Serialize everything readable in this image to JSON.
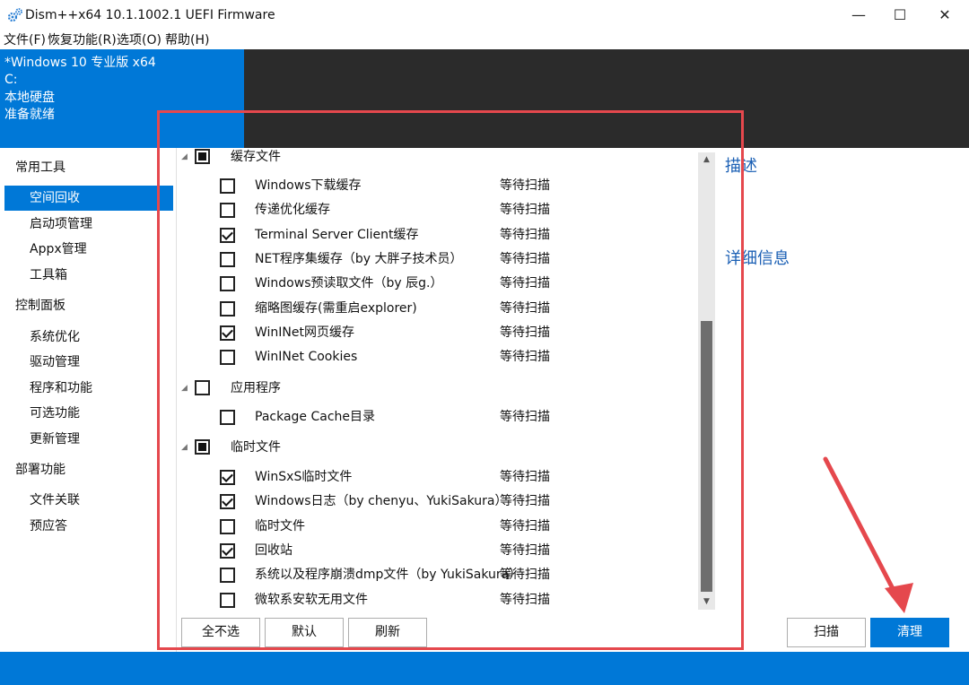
{
  "window": {
    "title": "Dism++x64 10.1.1002.1 UEFI Firmware",
    "minimize": "—",
    "maximize": "☐",
    "close": "✕"
  },
  "menu": [
    "文件(F)",
    "恢复功能(R)",
    "选项(O)",
    "帮助(H)"
  ],
  "header": {
    "lines": [
      "*Windows 10 专业版 x64",
      "C:",
      "本地硬盘",
      "准备就绪"
    ]
  },
  "sidebar": {
    "categories": [
      {
        "label": "常用工具",
        "items": [
          "空间回收",
          "启动项管理",
          "Appx管理",
          "工具箱"
        ]
      },
      {
        "label": "控制面板",
        "items": [
          "系统优化",
          "驱动管理",
          "程序和功能",
          "可选功能",
          "更新管理"
        ]
      },
      {
        "label": "部署功能",
        "items": [
          "文件关联",
          "预应答"
        ]
      }
    ],
    "selected": "空间回收"
  },
  "tree": {
    "groups": [
      {
        "label": "缓存文件",
        "state": "partial",
        "items": [
          {
            "label": "Windows下载缓存",
            "checked": false,
            "status": "等待扫描"
          },
          {
            "label": "传递优化缓存",
            "checked": false,
            "status": "等待扫描"
          },
          {
            "label": "Terminal Server Client缓存",
            "checked": true,
            "status": "等待扫描"
          },
          {
            "label": "NET程序集缓存（by 大胖子技术员）",
            "checked": false,
            "status": "等待扫描"
          },
          {
            "label": "Windows预读取文件（by 辰g.）",
            "checked": false,
            "status": "等待扫描"
          },
          {
            "label": "缩略图缓存(需重启explorer)",
            "checked": false,
            "status": "等待扫描"
          },
          {
            "label": "WinINet网页缓存",
            "checked": true,
            "status": "等待扫描"
          },
          {
            "label": "WinINet Cookies",
            "checked": false,
            "status": "等待扫描"
          }
        ]
      },
      {
        "label": "应用程序",
        "state": "unchecked",
        "items": [
          {
            "label": "Package Cache目录",
            "checked": false,
            "status": "等待扫描"
          }
        ]
      },
      {
        "label": "临时文件",
        "state": "partial",
        "items": [
          {
            "label": "WinSxS临时文件",
            "checked": true,
            "status": "等待扫描"
          },
          {
            "label": "Windows日志（by chenyu、YukiSakura）",
            "checked": true,
            "status": "等待扫描"
          },
          {
            "label": "临时文件",
            "checked": false,
            "status": "等待扫描"
          },
          {
            "label": "回收站",
            "checked": true,
            "status": "等待扫描"
          },
          {
            "label": "系统以及程序崩溃dmp文件（by YukiSakura）",
            "checked": false,
            "status": "等待扫描"
          },
          {
            "label": "微软系安软无用文件",
            "checked": false,
            "status": "等待扫描"
          }
        ]
      }
    ]
  },
  "right_panel": {
    "description_title": "描述",
    "detail_title": "详细信息"
  },
  "buttons": {
    "select_none": "全不选",
    "default": "默认",
    "refresh": "刷新",
    "scan": "扫描",
    "clean": "清理"
  },
  "icons": {
    "app": "gear-icon",
    "group_toggle": "collapse-triangle-icon",
    "scroll_up": "arrow-up-icon",
    "scroll_down": "arrow-down-icon"
  },
  "colors": {
    "accent": "#0078d7",
    "header_dark": "#2b2b2b",
    "annotation": "#e5484d",
    "link_title": "#1a5fb4"
  }
}
